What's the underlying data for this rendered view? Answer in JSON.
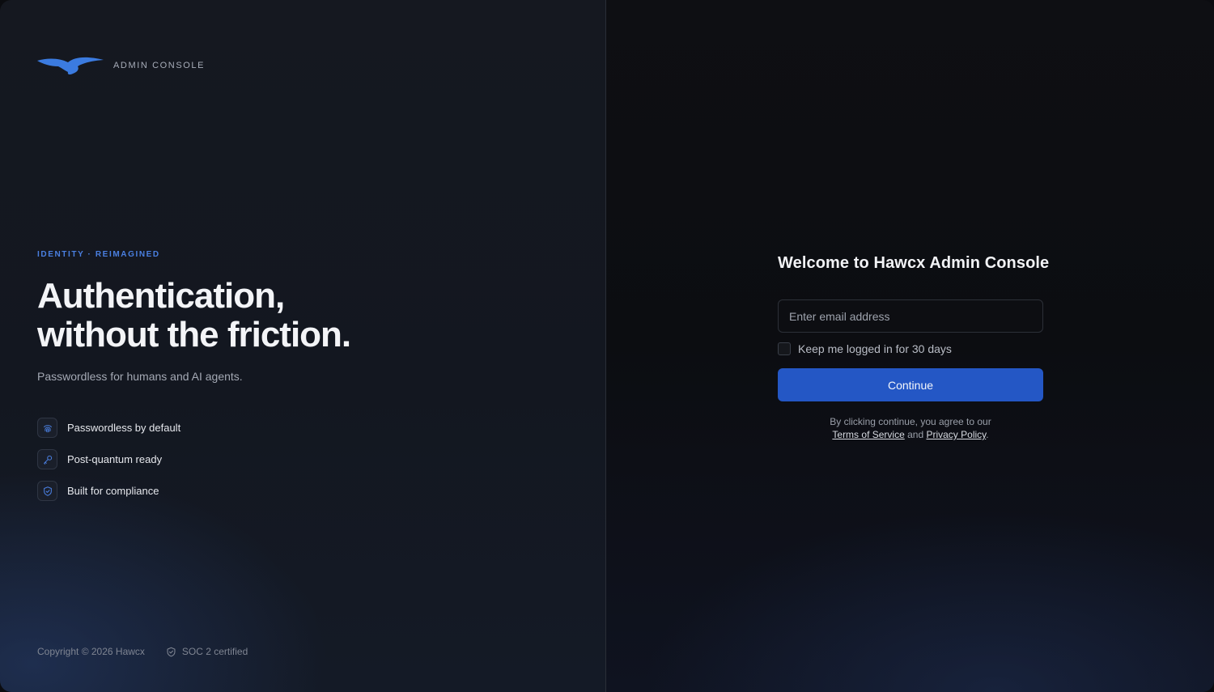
{
  "brand": {
    "logo_icon": "hawk-logo-icon",
    "console_label": "ADMIN CONSOLE",
    "accent": "#3b7be0"
  },
  "hero": {
    "eyebrow": "IDENTITY · REIMAGINED",
    "headline_line1": "Authentication,",
    "headline_line2": "without the friction.",
    "subline": "Passwordless for humans and AI agents."
  },
  "features": [
    {
      "icon": "fingerprint-icon",
      "label": "Passwordless by default"
    },
    {
      "icon": "key-icon",
      "label": "Post-quantum ready"
    },
    {
      "icon": "shield-check-icon",
      "label": "Built for compliance"
    }
  ],
  "footer": {
    "copyright": "Copyright © 2026 Hawcx",
    "soc_icon": "shield-check-icon",
    "soc_label": "SOC 2 certified"
  },
  "login": {
    "title": "Welcome to Hawcx Admin Console",
    "email_placeholder": "Enter email address",
    "email_value": "",
    "remember_label": "Keep me logged in for 30 days",
    "remember_checked": false,
    "continue_label": "Continue",
    "continue_color": "#2457c5",
    "legal_prefix": "By clicking continue, you agree to our",
    "terms_label": "Terms of Service",
    "legal_and": "and",
    "privacy_label": "Privacy Policy",
    "legal_suffix": "."
  }
}
